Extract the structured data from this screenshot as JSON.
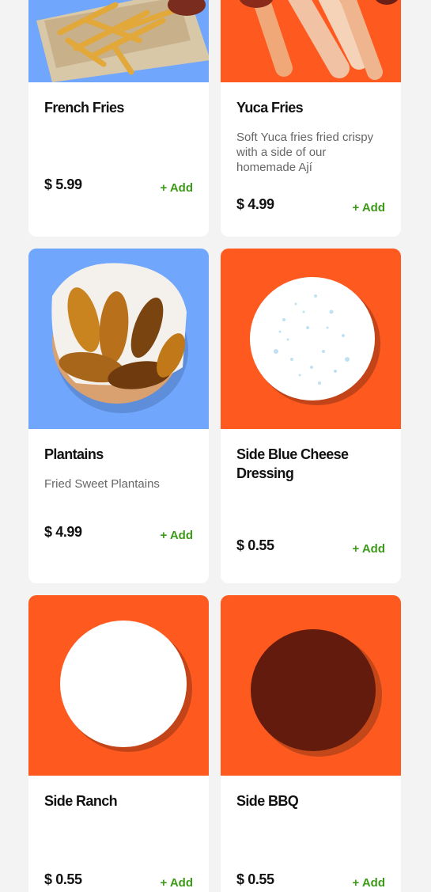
{
  "menu": {
    "add_label": "+ Add",
    "colors": {
      "blue_bg": "#70a6fb",
      "orange_bg": "#fe5a20",
      "add_green": "#3d9a18"
    },
    "items": [
      {
        "title": "French Fries",
        "description": "",
        "price": "$ 5.99",
        "image": "french-fries-photo"
      },
      {
        "title": "Yuca Fries",
        "description": "Soft Yuca fries fried crispy with a side of our homemade Ají",
        "price": "$ 4.99",
        "image": "yuca-fries-photo"
      },
      {
        "title": "Plantains",
        "description": "Fried Sweet Plantains",
        "price": "$ 4.99",
        "image": "plantains-photo"
      },
      {
        "title": "Side Blue Cheese Dressing",
        "description": "",
        "price": "$ 0.55",
        "image": "blue-cheese-dressing-photo"
      },
      {
        "title": "Side Ranch",
        "description": "",
        "price": "$ 0.55",
        "image": "ranch-dressing-photo"
      },
      {
        "title": "Side BBQ",
        "description": "",
        "price": "$ 0.55",
        "image": "bbq-sauce-photo"
      }
    ]
  }
}
